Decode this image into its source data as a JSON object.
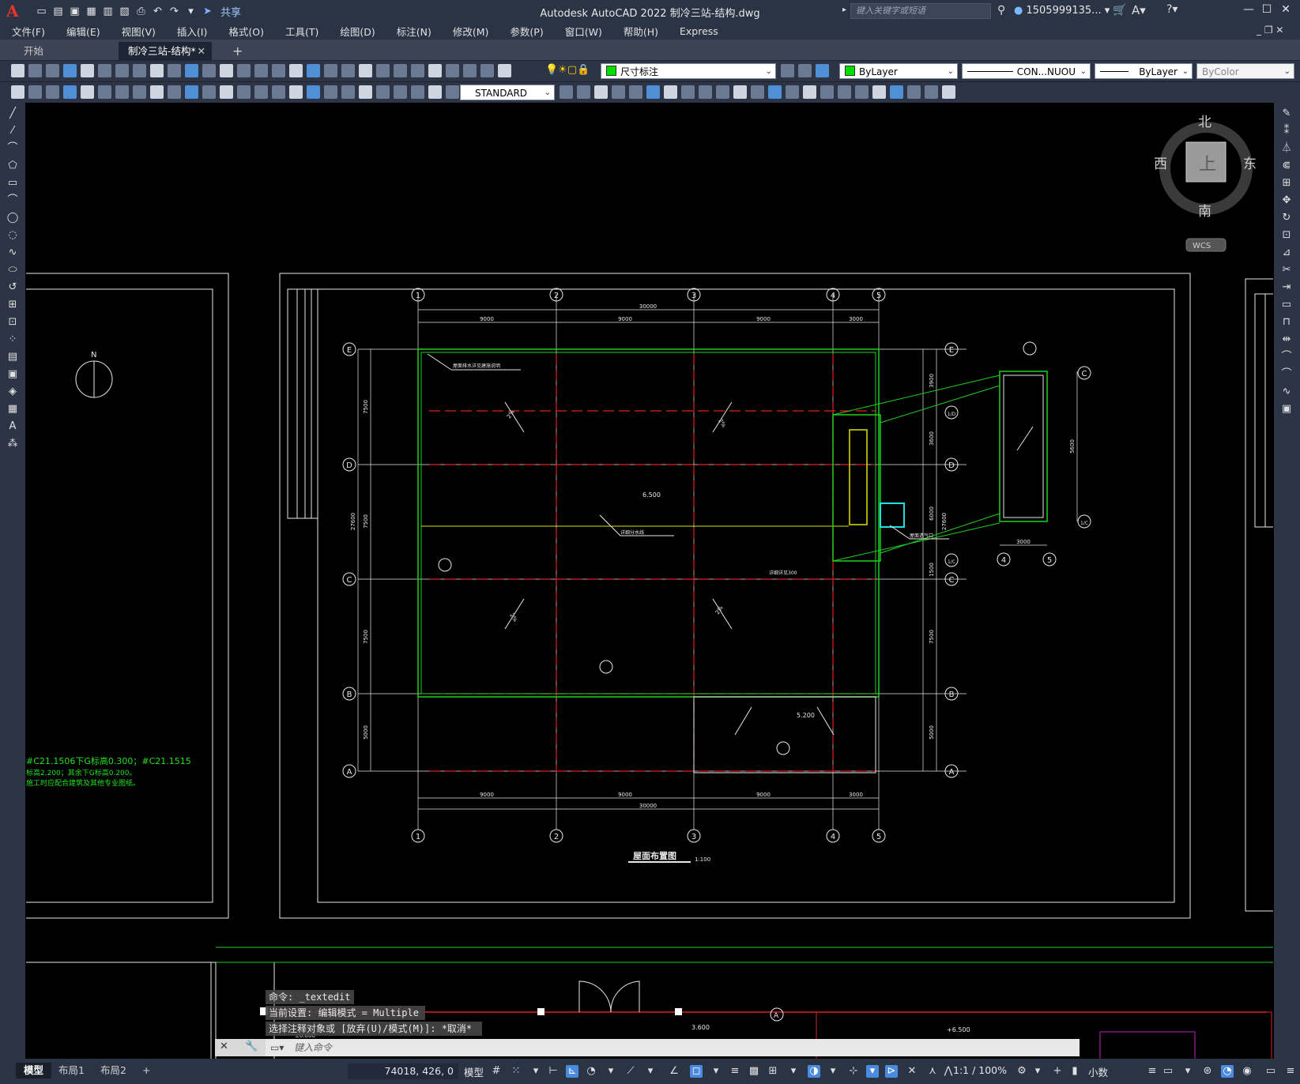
{
  "titlebar": {
    "logo": "A",
    "title": "Autodesk AutoCAD 2022    制冷三站-结构.dwg",
    "share": "共享",
    "search_placeholder": "键入关键字或短语",
    "user": "1505999135...",
    "qat_icons": [
      "new-icon",
      "open-icon",
      "save-icon",
      "saveas-icon",
      "publish-icon",
      "plot-preview-icon",
      "print-icon",
      "undo-icon",
      "redo-icon",
      "dropdown-icon"
    ]
  },
  "menu": [
    "文件(F)",
    "编辑(E)",
    "视图(V)",
    "插入(I)",
    "格式(O)",
    "工具(T)",
    "绘图(D)",
    "标注(N)",
    "修改(M)",
    "参数(P)",
    "窗口(W)",
    "帮助(H)",
    "Express"
  ],
  "tabs": {
    "start": "开始",
    "file": "制冷三站-结构*",
    "add": "+"
  },
  "toolbar1": {
    "layer": "尺寸标注",
    "color": "ByLayer",
    "linetype": "CON...NUOU",
    "lineweight": "ByLayer",
    "plotstyle": "ByColor"
  },
  "toolbar2": {
    "textstyle": "STANDARD"
  },
  "viewcube": {
    "north": "北",
    "south": "南",
    "east": "东",
    "west": "西",
    "face": "上",
    "wcs": "WCS"
  },
  "drawing": {
    "grid_top": [
      "1",
      "2",
      "3",
      "4",
      "5"
    ],
    "grid_right": [
      "E",
      "1/D",
      "D",
      "1/C",
      "C",
      "B",
      "A"
    ],
    "grid_left": [
      "E",
      "D",
      "C",
      "B",
      "A"
    ],
    "annex_grid": [
      "C",
      "1/C",
      "4",
      "5"
    ],
    "dims_top": [
      "30000",
      "9000",
      "9000",
      "9000",
      "3000"
    ],
    "dims_bottom": [
      "9000",
      "9000",
      "9000",
      "3000",
      "30000"
    ],
    "dims_left": [
      "7500",
      "27600",
      "7500",
      "7500",
      "5000"
    ],
    "dims_right": [
      "3900",
      "3600",
      "6000",
      "1500",
      "27600",
      "7500",
      "5000"
    ],
    "annex_dims": [
      "3000",
      "5600"
    ],
    "elev_main": "6.500",
    "elev_low": "5.200",
    "slope": "2%",
    "drawing_title": "屋面布置图",
    "scale": "1:100",
    "north_mark": "N",
    "note_a": "屋面排水详见建施说明",
    "note_b": "详细分水线",
    "note_c": "详细详见300",
    "note_d": "屋面透气口",
    "green_note_1": "#C21.1506下G标高0.300；#C21.1515",
    "green_note_2": "标高2.200；其余下G标高0.200。",
    "green_note_3": "施工时应配合建筑及其他专业图纸。",
    "bottom_elev_1": "3.600",
    "bottom_elev_2": "+6.500",
    "bottom_elev_3": "±0.000",
    "bottom_grid_a": "A"
  },
  "command": {
    "hist1": "命令: _textedit",
    "hist2": "当前设置: 编辑模式 = Multiple",
    "hist3": "选择注释对象或 [放弃(U)/模式(M)]: *取消*",
    "placeholder": "键入命令"
  },
  "statusbar": {
    "layouts": [
      "模型",
      "布局1",
      "布局2"
    ],
    "add": "+",
    "coords": "74018, 426, 0",
    "model": "模型",
    "scale": "1:1 / 100%",
    "units": "小数"
  },
  "colors": {
    "grid_red": "#e02020",
    "wall_green": "#20d020",
    "yellow": "#e0e000",
    "cyan": "#20e0e0",
    "ui_dark": "#2b3445"
  }
}
